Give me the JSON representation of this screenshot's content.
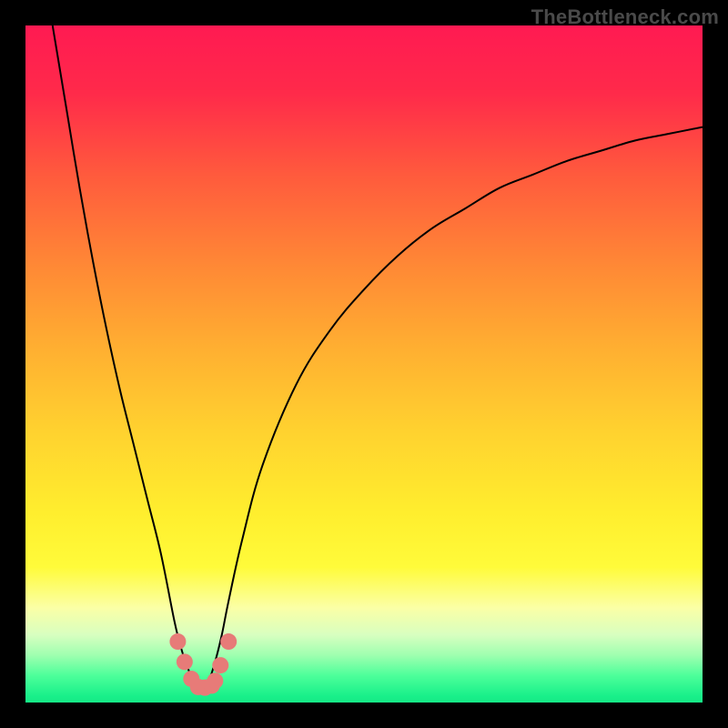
{
  "watermark": "TheBottleneck.com",
  "colors": {
    "frame": "#000000",
    "curve": "#000000",
    "marker": "#e77b78",
    "gradient_top": "#ff1a52",
    "gradient_bottom": "#16e886"
  },
  "chart_data": {
    "type": "line",
    "title": "",
    "xlabel": "",
    "ylabel": "",
    "xlim": [
      0,
      100
    ],
    "ylim": [
      0,
      100
    ],
    "grid": false,
    "legend": false,
    "note": "Values estimated from pixel positions; y=0 at bottom (green), y=100 at top (red). Two branches form a V with minimum near x≈26.",
    "series": [
      {
        "name": "left-branch",
        "x": [
          4,
          6,
          8,
          10,
          12,
          14,
          16,
          18,
          20,
          22,
          23,
          24,
          25,
          26
        ],
        "values": [
          100,
          88,
          76,
          65,
          55,
          46,
          38,
          30,
          22,
          12,
          8,
          5,
          3,
          2
        ]
      },
      {
        "name": "right-branch",
        "x": [
          26,
          27,
          28,
          29,
          30,
          32,
          35,
          40,
          45,
          50,
          55,
          60,
          65,
          70,
          75,
          80,
          85,
          90,
          95,
          100
        ],
        "values": [
          2,
          3,
          6,
          10,
          15,
          24,
          35,
          47,
          55,
          61,
          66,
          70,
          73,
          76,
          78,
          80,
          81.5,
          83,
          84,
          85
        ]
      }
    ],
    "markers": {
      "name": "highlighted-points",
      "x": [
        22.5,
        23.5,
        24.5,
        25.5,
        26.5,
        27.5,
        28,
        28.8,
        30
      ],
      "values": [
        9,
        6,
        3.5,
        2.3,
        2.2,
        2.5,
        3.2,
        5.5,
        9
      ]
    }
  }
}
